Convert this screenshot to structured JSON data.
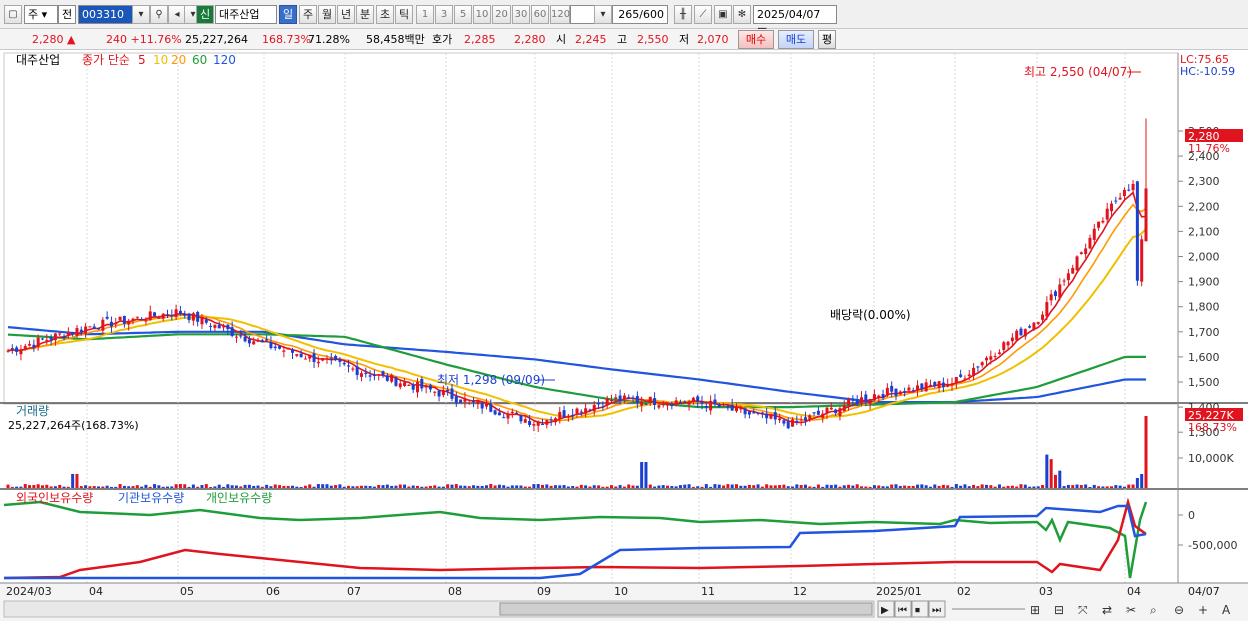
{
  "toolbar": {
    "market": "주",
    "market2": "전",
    "code": "003310",
    "badge": "신",
    "name": "대주산업",
    "periods": [
      "일",
      "주",
      "월",
      "년",
      "분",
      "초",
      "틱"
    ],
    "ranges": [
      "1",
      "3",
      "5",
      "10",
      "20",
      "30",
      "60",
      "120"
    ],
    "count": "265",
    "count_total": "/600",
    "date": "2025/04/07"
  },
  "info": {
    "price": "2,280",
    "change": "240",
    "change_pct": "+11.76%",
    "volume": "25,227,264",
    "vol_ratio": "168.73%",
    "turnover": "71.28%",
    "amount": "58,458백만",
    "quote_label": "호가",
    "quote_ask": "2,285",
    "quote_bid": "2,280",
    "open_label": "시",
    "open": "2,245",
    "high_label": "고",
    "high": "2,550",
    "low_label": "저",
    "low": "2,070",
    "buy_label": "매수",
    "sell_label": "매도",
    "eval_label": "평"
  },
  "price_panel": {
    "title": "대주산업",
    "ma_label": "종가 단순",
    "ma_periods": [
      "5",
      "10",
      "20",
      "60",
      "120"
    ],
    "ma_colors": [
      "#e0141e",
      "#f0c000",
      "#ff9900",
      "#1f9d3a",
      "#2255dd"
    ],
    "lc": "LC:75.65",
    "hc": "HC:-10.59",
    "high_note": "최고 2,550 (04/07)",
    "low_note": "최저 1,298 (09/09)",
    "dividend_note": "배당락(0.00%)",
    "last_label": "2,280",
    "last_pct": "11.76%",
    "yticks": [
      "2,500",
      "2,400",
      "2,300",
      "2,200",
      "2,100",
      "2,000",
      "1,900",
      "1,800",
      "1,700",
      "1,600",
      "1,500",
      "1,400",
      "1,300"
    ]
  },
  "volume_panel": {
    "title": "거래량",
    "value_text": "25,227,264주(168.73%)",
    "last_label": "25,227K",
    "last_pct": "168.73%",
    "ytick": "10,000K"
  },
  "holder_panel": {
    "titles": [
      "외국인보유수량",
      "기관보유수량",
      "개인보유수량"
    ],
    "colors": [
      "#e0141e",
      "#2255dd",
      "#1f9d3a"
    ],
    "yticks": [
      "0",
      "-500,000"
    ]
  },
  "xaxis": {
    "labels": [
      "2024/03",
      "04",
      "05",
      "06",
      "07",
      "08",
      "09",
      "10",
      "11",
      "12",
      "2025/01",
      "02",
      "03",
      "04"
    ],
    "end_label": "04/07"
  },
  "chart_data": {
    "type": "candlestick",
    "x": [
      "2024/03",
      "04",
      "05",
      "06",
      "07",
      "08",
      "09",
      "10",
      "11",
      "12",
      "2025/01",
      "02",
      "03",
      "04"
    ],
    "close_approx": [
      1620,
      1720,
      1780,
      1650,
      1560,
      1450,
      1340,
      1430,
      1420,
      1330,
      1450,
      1500,
      1750,
      2280
    ],
    "ma120_approx": [
      1720,
      1690,
      1700,
      1700,
      1650,
      1620,
      1590,
      1550,
      1510,
      1460,
      1420,
      1420,
      1440,
      1510
    ],
    "ma60_approx": [
      1690,
      1670,
      1690,
      1690,
      1680,
      1570,
      1480,
      1430,
      1400,
      1400,
      1410,
      1420,
      1480,
      1600
    ],
    "ylim": [
      1250,
      2580
    ],
    "high": {
      "value": 2550,
      "date": "04/07"
    },
    "low": {
      "value": 1298,
      "date": "09/09"
    }
  }
}
